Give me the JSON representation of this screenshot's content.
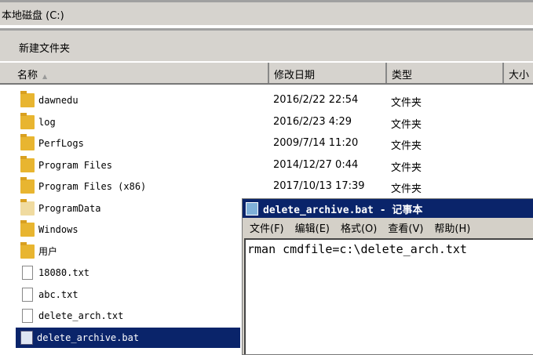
{
  "address": "本地磁盘 (C:)",
  "toolbar": {
    "new_folder": "新建文件夹"
  },
  "columns": {
    "name": "名称",
    "modified": "修改日期",
    "type": "类型",
    "size": "大小"
  },
  "files": [
    {
      "name": "dawnedu",
      "date": "2016/2/22 22:54",
      "type": "文件夹",
      "icon": "folder"
    },
    {
      "name": "log",
      "date": "2016/2/23 4:29",
      "type": "文件夹",
      "icon": "folder"
    },
    {
      "name": "PerfLogs",
      "date": "2009/7/14 11:20",
      "type": "文件夹",
      "icon": "folder"
    },
    {
      "name": "Program Files",
      "date": "2014/12/27 0:44",
      "type": "文件夹",
      "icon": "folder"
    },
    {
      "name": "Program Files (x86)",
      "date": "2017/10/13 17:39",
      "type": "文件夹",
      "icon": "folder"
    },
    {
      "name": "ProgramData",
      "icon": "folder-hidden"
    },
    {
      "name": "Windows",
      "icon": "folder"
    },
    {
      "name": "用户",
      "icon": "folder"
    },
    {
      "name": "18080.txt",
      "icon": "file"
    },
    {
      "name": "abc.txt",
      "icon": "file"
    },
    {
      "name": "delete_arch.txt",
      "icon": "file"
    },
    {
      "name": "delete_archive.bat",
      "icon": "batch-file"
    }
  ],
  "notepad": {
    "title": "delete_archive.bat - 记事本",
    "menu": [
      "文件(F)",
      "编辑(E)",
      "格式(O)",
      "查看(V)",
      "帮助(H)"
    ],
    "content": "rman cmdfile=c:\\delete_arch.txt"
  }
}
